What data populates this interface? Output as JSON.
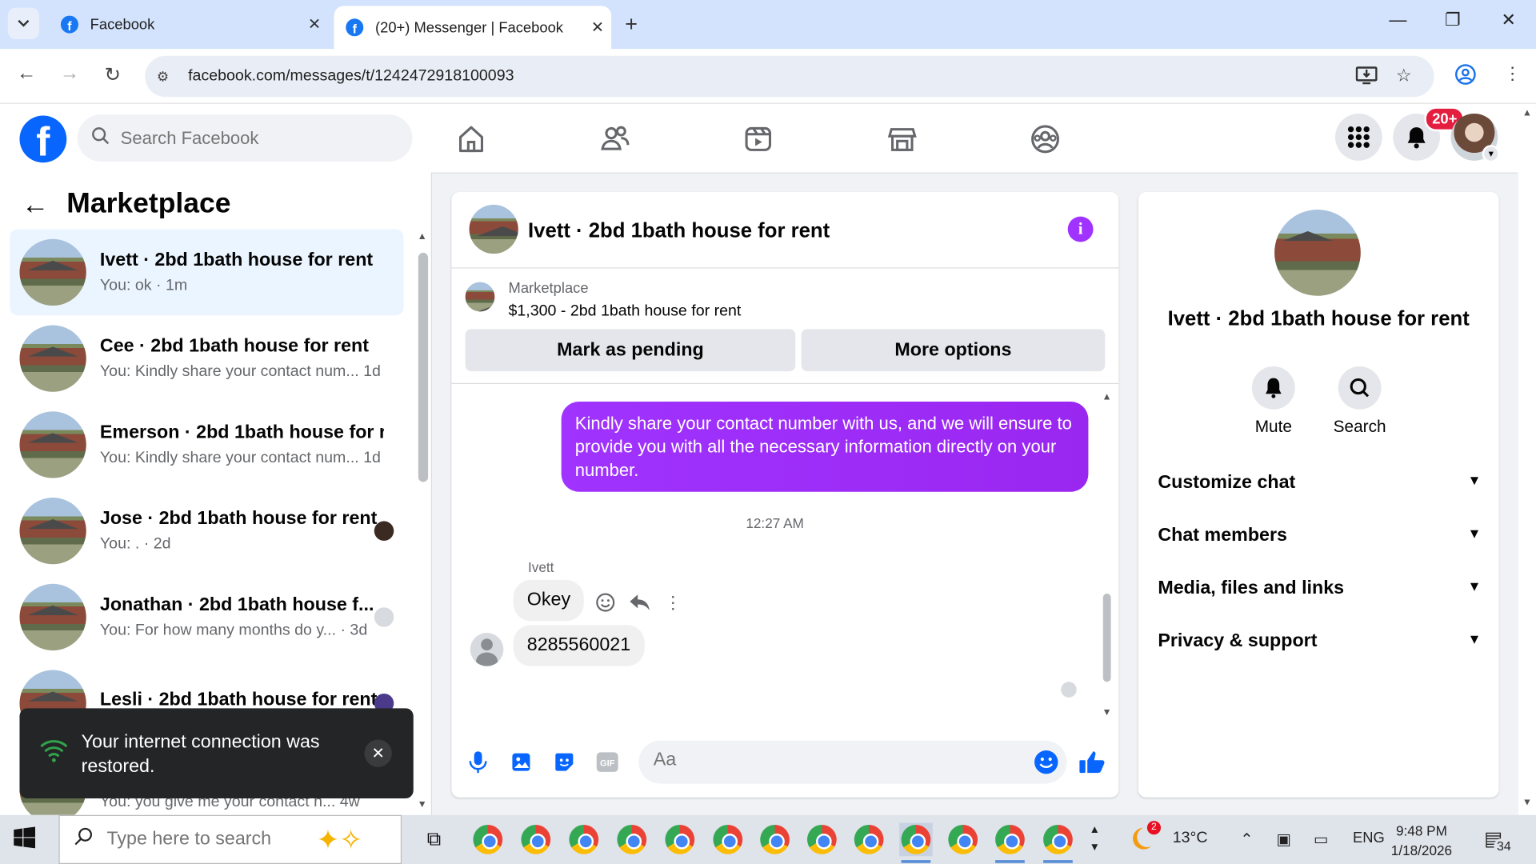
{
  "browser": {
    "tabs": [
      {
        "title": "Facebook",
        "active": false
      },
      {
        "title": "(20+) Messenger | Facebook",
        "active": true
      }
    ],
    "url": "facebook.com/messages/t/1242472918100093"
  },
  "fb_header": {
    "search_placeholder": "Search Facebook",
    "notification_badge": "20+"
  },
  "left_panel": {
    "title": "Marketplace",
    "conversations": [
      {
        "name": "Ivett · 2bd 1bath house for rent",
        "snippet": "You: ok · 1m",
        "selected": true
      },
      {
        "name": "Cee · 2bd 1bath house for rent",
        "snippet": "You: Kindly share your contact num...  1d"
      },
      {
        "name": "Emerson · 2bd 1bath house for r...",
        "snippet": "You: Kindly share your contact num...  1d"
      },
      {
        "name": "Jose · 2bd 1bath house for rent",
        "snippet": "You: . · 2d"
      },
      {
        "name": "Jonathan · 2bd 1bath house f...",
        "snippet": "You: For how many months do y... · 3d"
      },
      {
        "name": "Lesli · 2bd 1bath house for rent",
        "snippet": ""
      }
    ],
    "hidden_snippet": "You: you give me your contact n...  4w"
  },
  "toast": {
    "message": "Your internet connection was restored."
  },
  "chat": {
    "title": "Ivett · 2bd 1bath house for rent",
    "marketplace_label": "Marketplace",
    "listing": "$1,300 - 2bd 1bath house for rent",
    "mark_pending_label": "Mark as pending",
    "more_options_label": "More options",
    "outgoing_message": "Kindly share your contact number with us, and we will ensure to provide you with all the necessary information directly on your number.",
    "timestamp": "12:27 AM",
    "sender_name": "Ivett",
    "incoming_messages": [
      "Okey",
      "8285560021"
    ],
    "composer_placeholder": "Aa"
  },
  "right_panel": {
    "name": "Ivett · 2bd 1bath house for rent",
    "actions": [
      {
        "label": "Mute"
      },
      {
        "label": "Search"
      }
    ],
    "sections": [
      "Customize chat",
      "Chat members",
      "Media, files and links",
      "Privacy & support"
    ]
  },
  "taskbar": {
    "search_placeholder": "Type here to search",
    "weather_temp": "13°C",
    "weather_badge": "2",
    "language": "ENG",
    "time": "9:48 PM",
    "date": "1/18/2026",
    "notification_count": "34"
  },
  "colors": {
    "fb_blue": "#0866ff",
    "messenger_purple": "#a033ff",
    "selected_conv_bg": "#ebf5ff",
    "badge_red": "#e41e3f"
  }
}
